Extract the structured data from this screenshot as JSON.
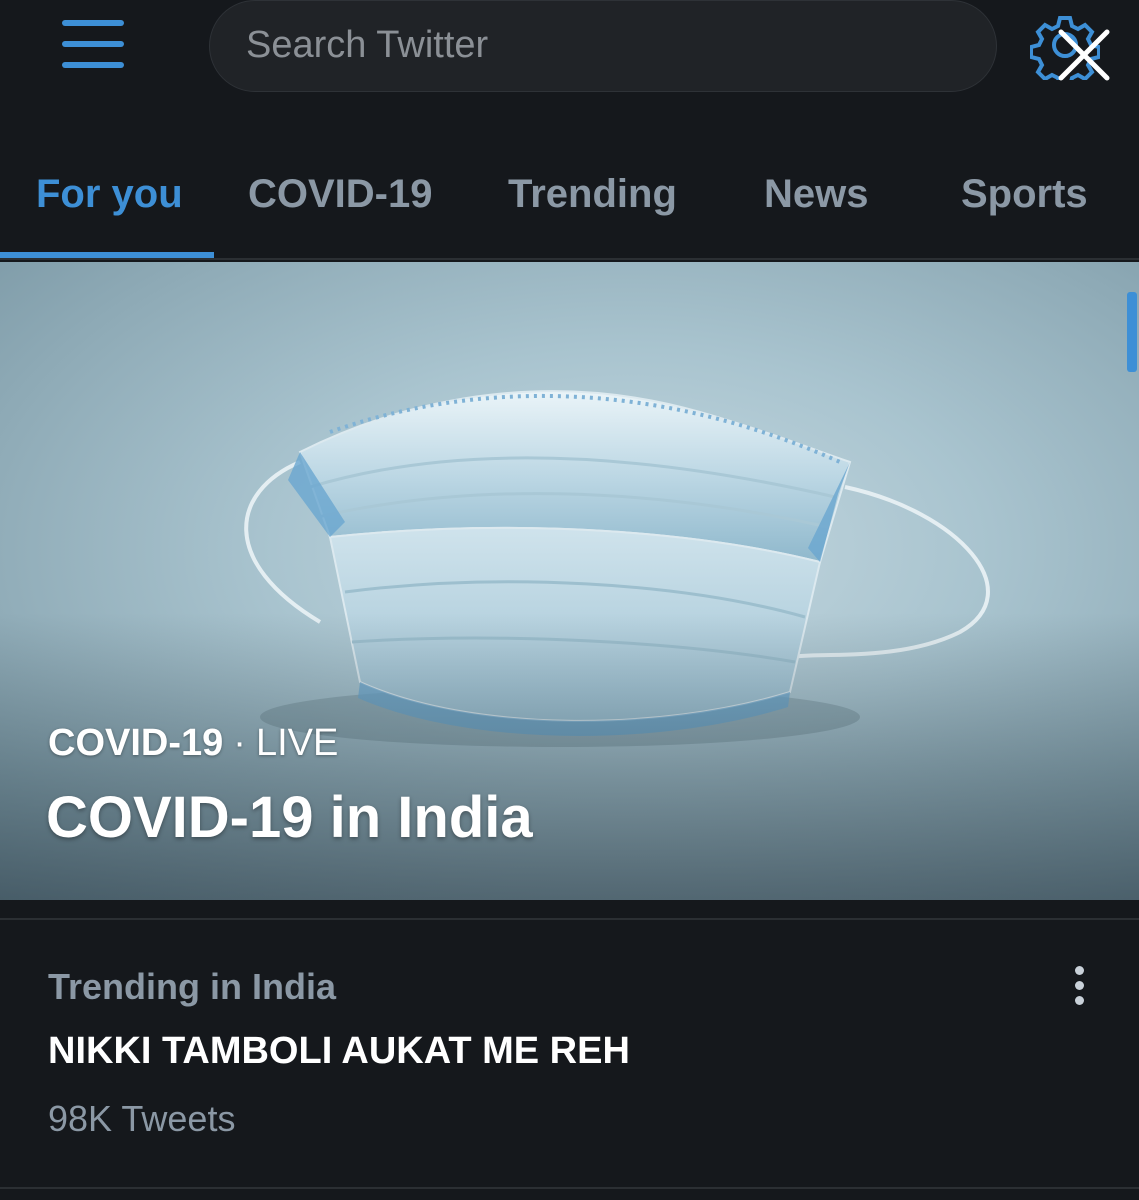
{
  "header": {
    "search_placeholder": "Search Twitter",
    "icons": [
      "hamburger-menu-icon",
      "settings-gear-icon",
      "close-icon"
    ],
    "accent_color": "#3d8fd6"
  },
  "tabs": [
    {
      "label": "For you",
      "active": true
    },
    {
      "label": "COVID-19",
      "active": false
    },
    {
      "label": "Trending",
      "active": false
    },
    {
      "label": "News",
      "active": false
    },
    {
      "label": "Sports",
      "active": false
    }
  ],
  "hero": {
    "category": "COVID-19",
    "separator": "·",
    "status": "LIVE",
    "title": "COVID-19 in India",
    "image": "surgical-mask-photo"
  },
  "trend": {
    "context": "Trending in India",
    "name": "NIKKI TAMBOLI AUKAT ME REH",
    "count": "98K Tweets"
  }
}
